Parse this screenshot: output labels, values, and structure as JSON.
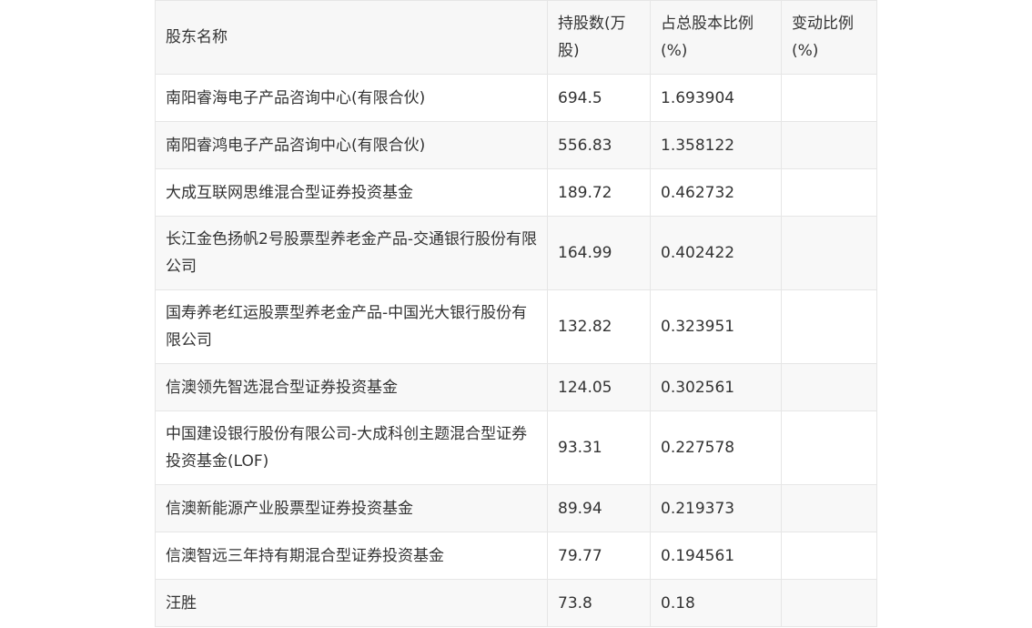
{
  "table": {
    "headers": [
      "股东名称",
      "持股数(万股)",
      "占总股本比例(%)",
      "变动比例(%)"
    ],
    "rows": [
      [
        "南阳睿海电子产品咨询中心(有限合伙)",
        "694.5",
        "1.693904",
        ""
      ],
      [
        "南阳睿鸿电子产品咨询中心(有限合伙)",
        "556.83",
        "1.358122",
        ""
      ],
      [
        "大成互联网思维混合型证券投资基金",
        "189.72",
        "0.462732",
        ""
      ],
      [
        "长江金色扬帆2号股票型养老金产品-交通银行股份有限公司",
        "164.99",
        "0.402422",
        ""
      ],
      [
        "国寿养老红运股票型养老金产品-中国光大银行股份有限公司",
        "132.82",
        "0.323951",
        ""
      ],
      [
        "信澳领先智选混合型证券投资基金",
        "124.05",
        "0.302561",
        ""
      ],
      [
        "中国建设银行股份有限公司-大成科创主题混合型证券投资基金(LOF)",
        "93.31",
        "0.227578",
        ""
      ],
      [
        "信澳新能源产业股票型证券投资基金",
        "89.94",
        "0.219373",
        ""
      ],
      [
        "信澳智远三年持有期混合型证券投资基金",
        "79.77",
        "0.194561",
        ""
      ],
      [
        "汪胜",
        "73.8",
        "0.18",
        ""
      ]
    ]
  }
}
